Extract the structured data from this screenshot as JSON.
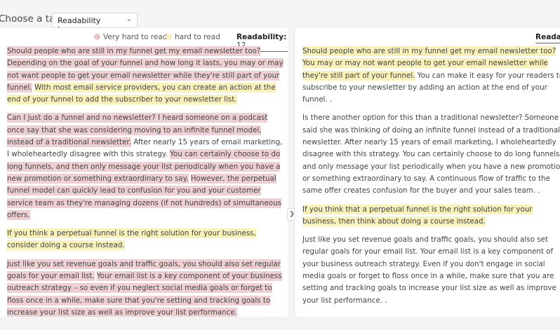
{
  "toolbar": {
    "task_label": "Choose a task",
    "task_value": "Readability improver"
  },
  "legend": {
    "very_hard": "Very hard to read",
    "hard": "hard to read",
    "very_hard_color": "#e9c3c6",
    "hard_color": "#f6eebd"
  },
  "left": {
    "readability_label": "Readability:",
    "readability_value": "12",
    "paragraphs": [
      [
        {
          "t": "Should people who are still in my funnel get my email newsletter too? Depending on the goal of your funnel and how long it lasts, you may or may not want people to get your email newsletter while they're still part of your funnel.",
          "h": "pink"
        },
        {
          "t": " ",
          "h": ""
        },
        {
          "t": "With most email service providers, you can create an action at the end of your funnel to add the subscriber to your newsletter list.",
          "h": "yellow"
        }
      ],
      [
        {
          "t": "Can I just do a funnel and no newsletter? I heard someone on a podcast once say that she was considering moving to an infinite funnel model, instead of a traditional newsletter.",
          "h": "pink"
        },
        {
          "t": " After nearly 15 years of email marketing, I wholeheartedly disagree with this strategy. ",
          "h": ""
        },
        {
          "t": "You can certainly choose to do long funnels, and then only message your list periodically when you have a new promotion or something extraordinary to say.",
          "h": "pink"
        },
        {
          "t": " ",
          "h": ""
        },
        {
          "t": "However, the perpetual funnel model can quickly lead to confusion for you and your customer service team as they're managing dozens (if not hundreds) of simultaneous offers.",
          "h": "pink"
        }
      ],
      [
        {
          "t": "If you think a perpetual funnel is the right solution for your business, consider doing a course instead.",
          "h": "yellow"
        }
      ],
      [
        {
          "t": "Just like you set revenue goals and traffic goals, you should also set regular goals for your email list.",
          "h": "pink"
        },
        {
          "t": " ",
          "h": ""
        },
        {
          "t": "Your email list is a key component of your business outreach strategy – so even if you neglect social media goals or forget to floss once in a while, make sure that you're setting and tracking goals to increase your list size as well as improve your list performance.",
          "h": "pink"
        }
      ]
    ]
  },
  "right": {
    "readability_label": "Readab",
    "paragraphs": [
      [
        {
          "t": "Should people who are still in my funnel get my email newsletter too? You may or may not want people to get your email newsletter while they're still part of your funnel.",
          "h": "yellow"
        },
        {
          "t": " You can make it easy for your readers to subscribe to your newsletter by adding an action at the end of your funnel. .",
          "h": ""
        }
      ],
      [
        {
          "t": "Is there another option for this than a traditional newsletter? Someone said she was thinking of doing an infinite funnel instead of a traditional newsletter. After nearly 15 years of email marketing, I wholeheartedly disagree with this strategy. You can certainly choose to do long funnels and only message your list periodically when you have a new promotion or something extraordinary to say. A continuous flow of traffic to the same offer creates confusion for the buyer and your sales team. .",
          "h": ""
        }
      ],
      [
        {
          "t": "If you think that a perpetual funnel is the right solution for your business, then think about doing a course instead.",
          "h": "yellow"
        }
      ],
      [
        {
          "t": "Just like you set revenue goals and traffic goals, you should also set regular goals for your email list. Your email list is a key component of your business outreach strategy. Even if you don't engage in social media goals or forget to floss once in a while, make sure that you are setting and tracking goals to increase your list size as well as improve your list performance. .",
          "h": ""
        }
      ]
    ]
  }
}
